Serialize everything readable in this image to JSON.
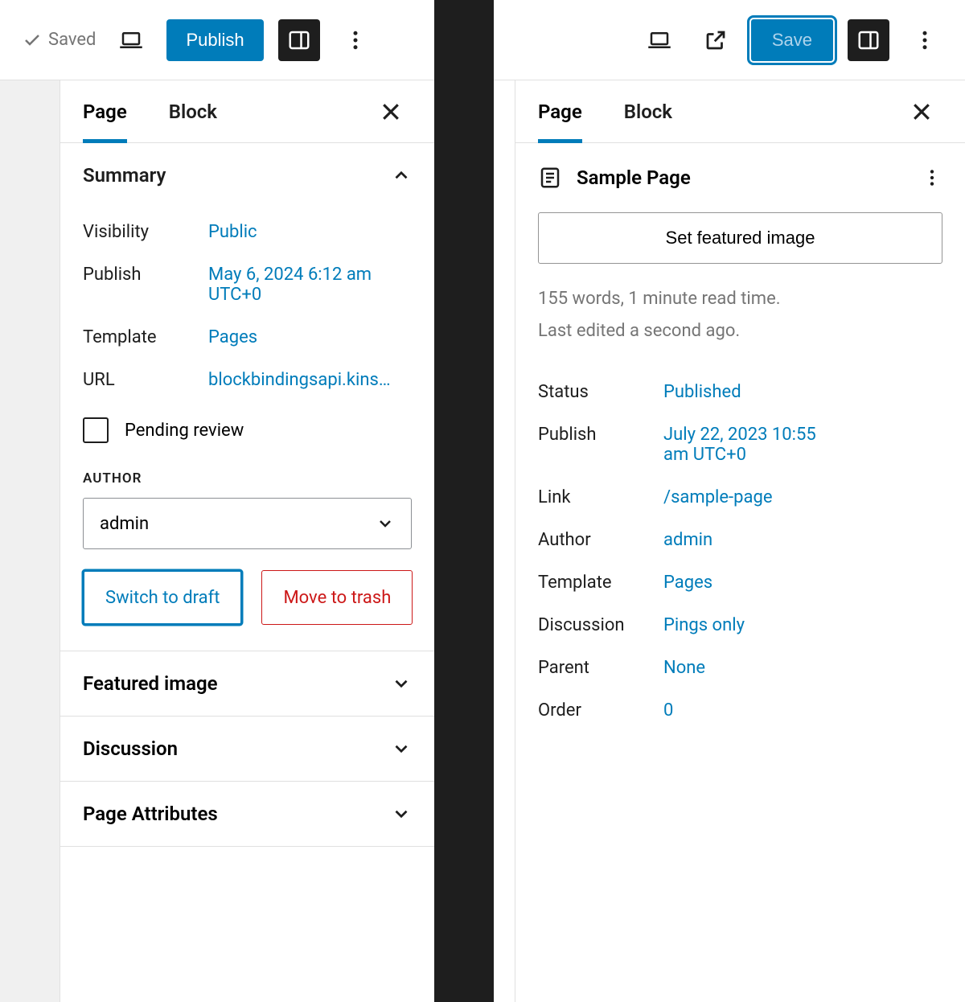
{
  "left": {
    "topbar": {
      "saved_label": "Saved",
      "publish_label": "Publish"
    },
    "tabs": {
      "page": "Page",
      "block": "Block"
    },
    "summary": {
      "title": "Summary",
      "visibility_label": "Visibility",
      "visibility_value": "Public",
      "publish_label": "Publish",
      "publish_value": "May 6, 2024 6:12 am UTC+0",
      "template_label": "Template",
      "template_value": "Pages",
      "url_label": "URL",
      "url_value": "blockbindingsapi.kins…",
      "pending_review": "Pending review",
      "author_heading": "AUTHOR",
      "author_value": "admin",
      "switch_draft": "Switch to draft",
      "move_trash": "Move to trash"
    },
    "sections": {
      "featured_image": "Featured image",
      "discussion": "Discussion",
      "page_attributes": "Page Attributes"
    }
  },
  "right": {
    "topbar": {
      "save_label": "Save"
    },
    "tabs": {
      "page": "Page",
      "block": "Block"
    },
    "page_title": "Sample Page",
    "featured_button": "Set featured image",
    "meta_line1": "155 words, 1 minute read time.",
    "meta_line2": "Last edited a second ago.",
    "rows": {
      "status_label": "Status",
      "status_value": "Published",
      "publish_label": "Publish",
      "publish_value": "July 22, 2023 10:55 am UTC+0",
      "link_label": "Link",
      "link_value": "/sample-page",
      "author_label": "Author",
      "author_value": "admin",
      "template_label": "Template",
      "template_value": "Pages",
      "discussion_label": "Discussion",
      "discussion_value": "Pings only",
      "parent_label": "Parent",
      "parent_value": "None",
      "order_label": "Order",
      "order_value": "0"
    }
  }
}
